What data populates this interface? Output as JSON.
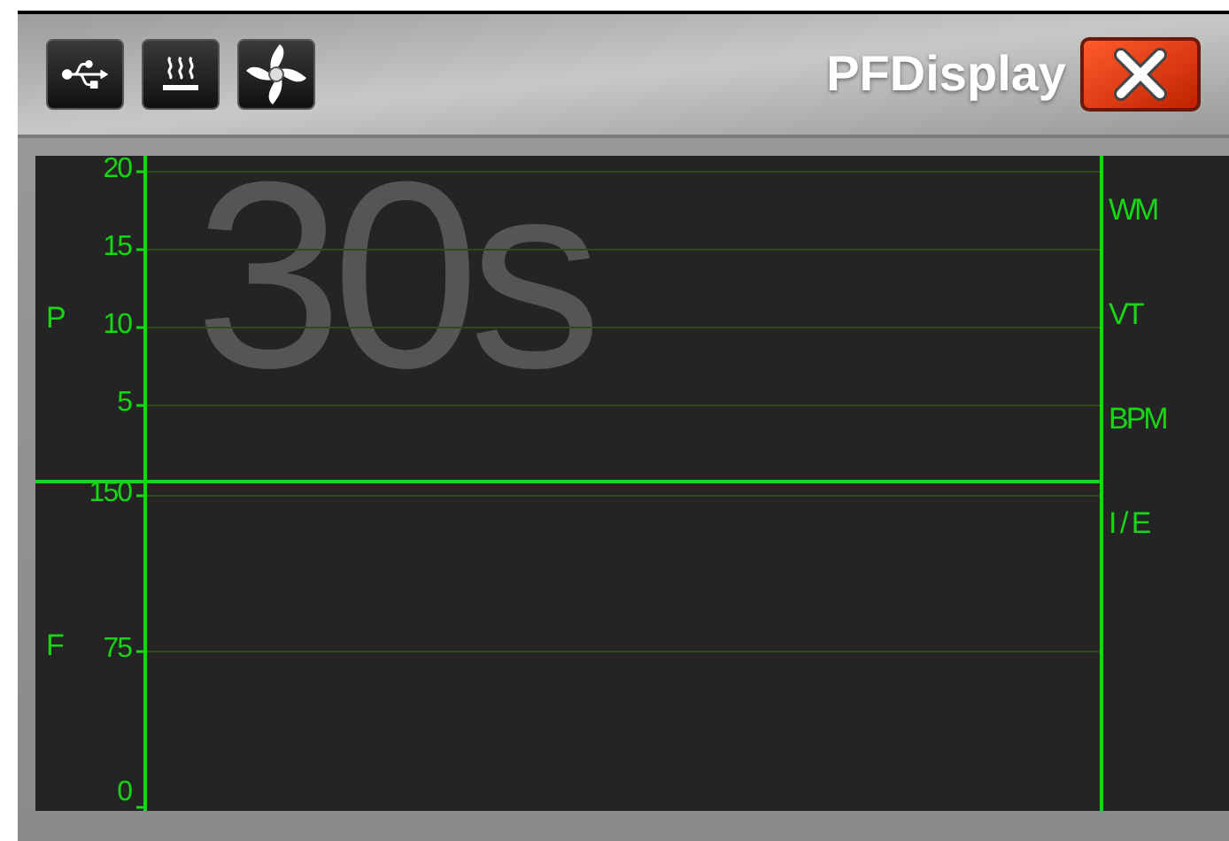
{
  "window": {
    "title": "PFDisplay"
  },
  "toolbar": [
    {
      "kind": "usb"
    },
    {
      "kind": "heater"
    },
    {
      "kind": "fan"
    }
  ],
  "plot": {
    "elapsed": "30s",
    "panels": [
      {
        "label": "P",
        "ticks": [
          "20",
          "15",
          "10",
          "5"
        ]
      },
      {
        "label": "F",
        "ticks": [
          "150",
          "75",
          "0"
        ]
      }
    ],
    "readouts": [
      "WM",
      "VT",
      "BPM",
      "I / E"
    ]
  }
}
